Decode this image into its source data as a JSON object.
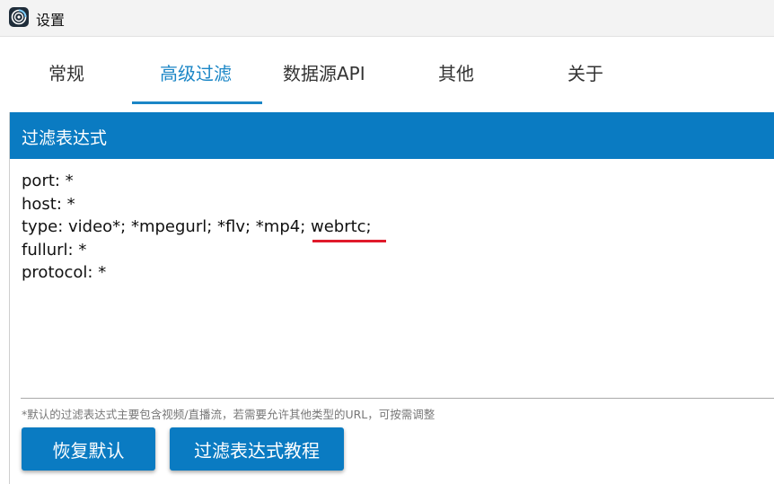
{
  "window": {
    "title": "设置",
    "icon": "app-logo-icon"
  },
  "tabs": [
    {
      "label": "常规",
      "active": false
    },
    {
      "label": "高级过滤",
      "active": true
    },
    {
      "label": "数据源API",
      "active": false
    },
    {
      "label": "其他",
      "active": false
    },
    {
      "label": "关于",
      "active": false
    }
  ],
  "panel": {
    "title": "过滤表达式",
    "expression": "port: *\nhost: *\ntype: video*; *mpegurl; *flv; *mp4; webrtc;\nfullurl: *\nprotocol: *",
    "hint": "*默认的过滤表达式主要包含视频/直播流，若需要允许其他类型的URL，可按需调整",
    "reset_label": "恢复默认",
    "tutorial_label": "过滤表达式教程"
  },
  "colors": {
    "accent": "#0a7bc2",
    "tab_active": "#1b86c6",
    "annotation_underline": "#e01a2b"
  }
}
